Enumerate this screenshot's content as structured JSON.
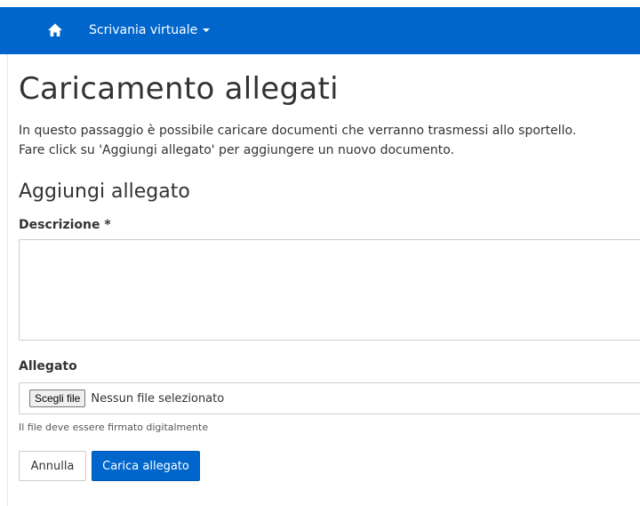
{
  "navbar": {
    "home_icon": "home-icon",
    "dropdown_label": "Scrivania virtuale",
    "bg_color": "#0066cc"
  },
  "page": {
    "title": "Caricamento allegati",
    "intro_line1": "In questo passaggio è possibile caricare documenti che verranno trasmessi allo sportello.",
    "intro_line2": "Fare click su 'Aggiungi allegato' per aggiungere un nuovo documento."
  },
  "form": {
    "section_title": "Aggiungi allegato",
    "description_label": "Descrizione *",
    "description_value": "",
    "attachment_label": "Allegato",
    "choose_file_label": "Scegli file",
    "no_file_text": "Nessun file selezionato",
    "help_text": "Il file deve essere firmato digitalmente"
  },
  "actions": {
    "cancel_label": "Annulla",
    "upload_label": "Carica allegato",
    "primary_color": "#0066cc"
  }
}
